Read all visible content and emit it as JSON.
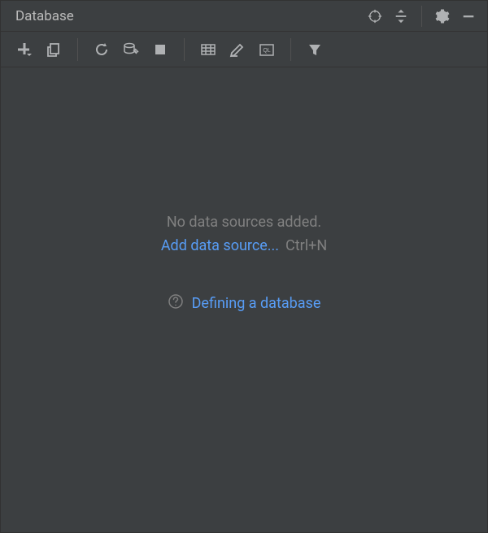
{
  "panel": {
    "title": "Database"
  },
  "content": {
    "empty_message": "No data sources added.",
    "add_link": "Add data source...",
    "add_shortcut": "Ctrl+N",
    "help_link": "Defining a database"
  }
}
